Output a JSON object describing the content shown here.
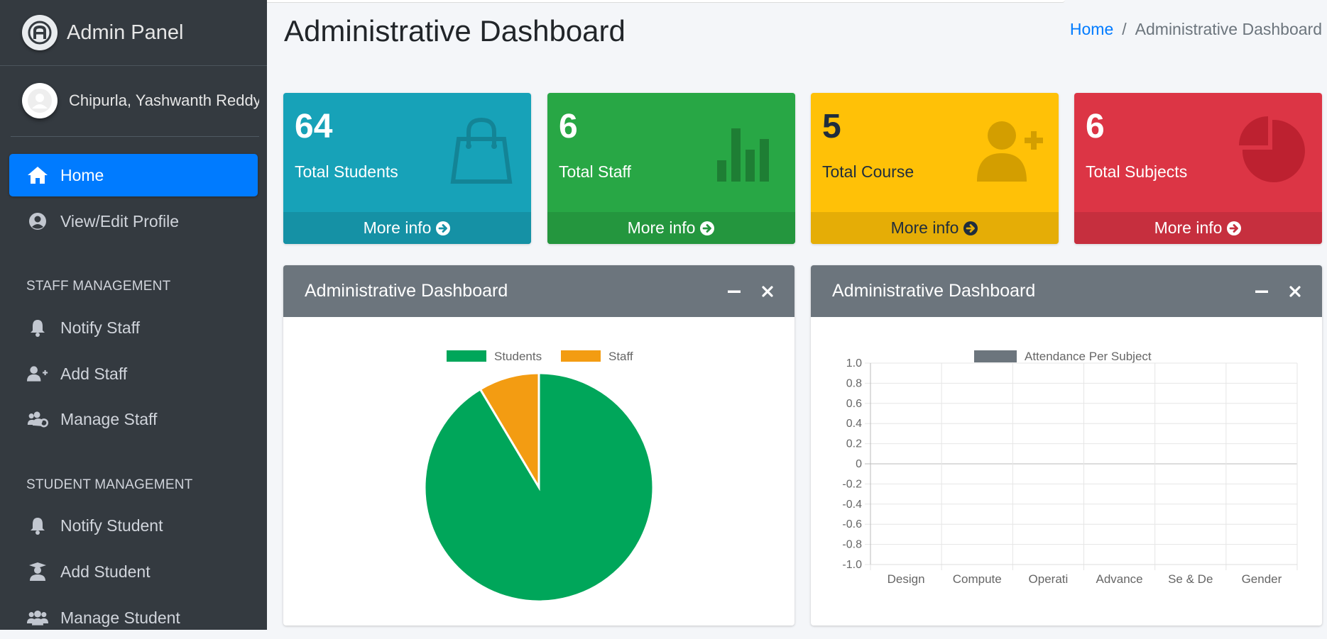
{
  "brand": {
    "name": "Admin Panel"
  },
  "user": {
    "name": "Chipurla, Yashwanth Reddy"
  },
  "sidebar": {
    "items": [
      {
        "label": "Home"
      },
      {
        "label": "View/Edit Profile"
      },
      {
        "label": "Notify Staff"
      },
      {
        "label": "Add Staff"
      },
      {
        "label": "Manage Staff"
      },
      {
        "label": "Notify Student"
      },
      {
        "label": "Add Student"
      },
      {
        "label": "Manage Student"
      }
    ],
    "headers": [
      "STAFF MANAGEMENT",
      "STUDENT MANAGEMENT"
    ]
  },
  "page": {
    "title": "Administrative Dashboard"
  },
  "breadcrumb": {
    "home": "Home",
    "sep": "/",
    "current": "Administrative Dashboard"
  },
  "stats": [
    {
      "value": "64",
      "label": "Total Students",
      "more": "More info",
      "color": "#17a2b8",
      "footer_color": "#1591a5",
      "icon": "shopping-bag-icon"
    },
    {
      "value": "6",
      "label": "Total Staff",
      "more": "More info",
      "color": "#28a745",
      "footer_color": "#24963e",
      "icon": "bar-chart-icon"
    },
    {
      "value": "5",
      "label": "Total Course",
      "more": "More info",
      "color": "#ffc107",
      "footer_color": "#e5ad06",
      "icon": "user-plus-icon"
    },
    {
      "value": "6",
      "label": "Total Subjects",
      "more": "More info",
      "color": "#dc3545",
      "footer_color": "#c62f3e",
      "icon": "pie-chart-icon"
    }
  ],
  "cards": [
    {
      "title": "Administrative Dashboard"
    },
    {
      "title": "Administrative Dashboard"
    }
  ],
  "chart_data": [
    {
      "type": "pie",
      "labels": [
        "Students",
        "Staff"
      ],
      "values": [
        64,
        6
      ],
      "colors": [
        "#00a65a",
        "#f39c12"
      ],
      "legend": "top"
    },
    {
      "type": "bar",
      "categories": [
        "Design",
        "Compute",
        "Operati",
        "Advance",
        "Se & De",
        "Gender"
      ],
      "series": [
        {
          "name": "Attendance Per Subject",
          "values": [
            0,
            0,
            0,
            0,
            0,
            0
          ],
          "color": "#6c757d"
        }
      ],
      "ylim": [
        -1.0,
        1.0
      ],
      "yticks": [
        "1.0",
        "0.8",
        "0.6",
        "0.4",
        "0.2",
        "0",
        "-0.2",
        "-0.4",
        "-0.6",
        "-0.8",
        "-1.0"
      ],
      "grid": true,
      "legend": "top"
    }
  ]
}
